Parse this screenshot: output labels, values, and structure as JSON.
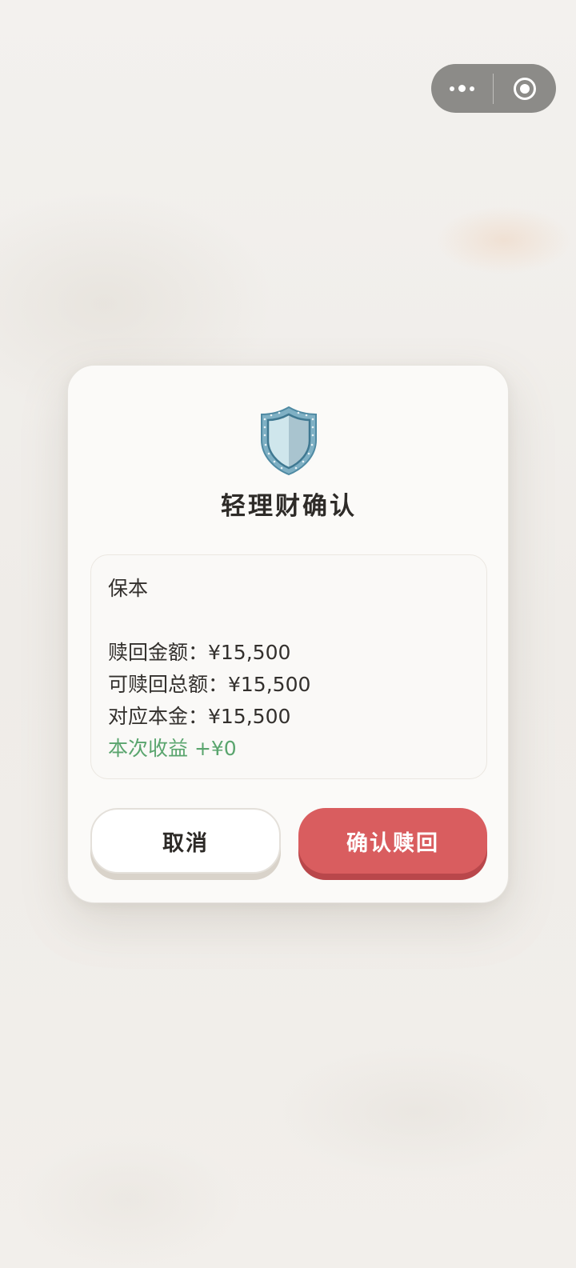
{
  "capsule": {
    "more_icon": "more-dots-icon",
    "close_icon": "close-target-icon"
  },
  "dialog": {
    "icon": "shield-icon",
    "title": "轻理财确认",
    "info": {
      "type_label": "保本",
      "redeem_amount": "赎回金额：¥15,500",
      "redeemable_total": "可赎回总额：¥15,500",
      "principal": "对应本金：¥15,500",
      "gain": "本次收益 +¥0"
    },
    "buttons": {
      "cancel": "取消",
      "confirm": "确认赎回"
    }
  },
  "colors": {
    "confirm_button": "#d95d5f",
    "gain_text": "#5aa56e",
    "capsule": "#8c8b88"
  }
}
